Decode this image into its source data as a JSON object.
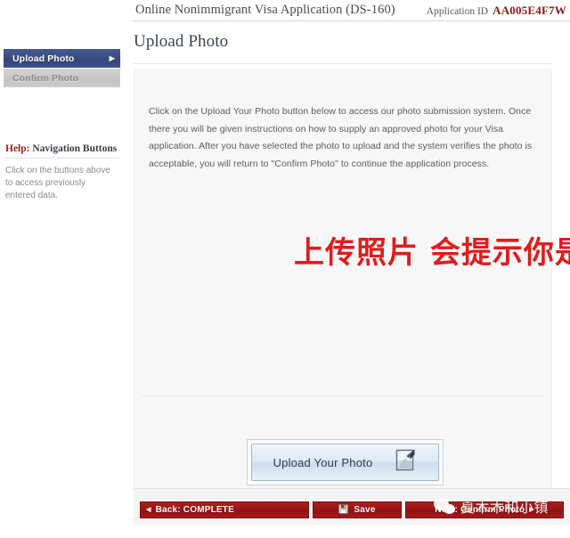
{
  "header": {
    "app_title": "Online Nonimmigrant Visa Application (DS-160)",
    "application_id_label": "Application ID",
    "application_id_value": "AA005E4F7W"
  },
  "sidebar": {
    "nav_items": [
      {
        "label": "Upload Photo",
        "state": "active",
        "arrow": "▶"
      },
      {
        "label": "Confirm Photo",
        "state": "disabled",
        "arrow": ""
      }
    ],
    "help": {
      "title_emphasis": "Help:",
      "title_rest": " Navigation Buttons",
      "body": "Click on the buttons above to access previously entered data."
    }
  },
  "main": {
    "page_title": "Upload Photo",
    "instructions": "Click on the Upload Your Photo button below to access our photo submission system. Once there you will be given instructions on how to supply an approved photo for your Visa application. After you have selected the photo to upload and the system verifies the photo is acceptable, you will return to \"Confirm Photo\" to continue the application process.",
    "upload_button_label": "Upload Your Photo",
    "upload_button_icon": "document-upload-icon",
    "annotation_text": "上传照片  会提示你是否合格"
  },
  "footer": {
    "back_label": "Back: COMPLETE",
    "back_arrow": "◀",
    "save_label": "Save",
    "save_icon": "floppy-disk-icon",
    "next_label": "Next: Confirm Photo",
    "next_arrow": "▶"
  },
  "watermark": {
    "logo": "wechat-logo",
    "text": "夏木木和小镇"
  },
  "colors": {
    "nav_active": "#3a4d82",
    "nav_disabled": "#c9c9c9",
    "footer_red": "#9a1515",
    "app_id_red": "#8b1a1a",
    "annotation_red": "#e01c1c",
    "panel_bg": "#f7f7f7"
  }
}
